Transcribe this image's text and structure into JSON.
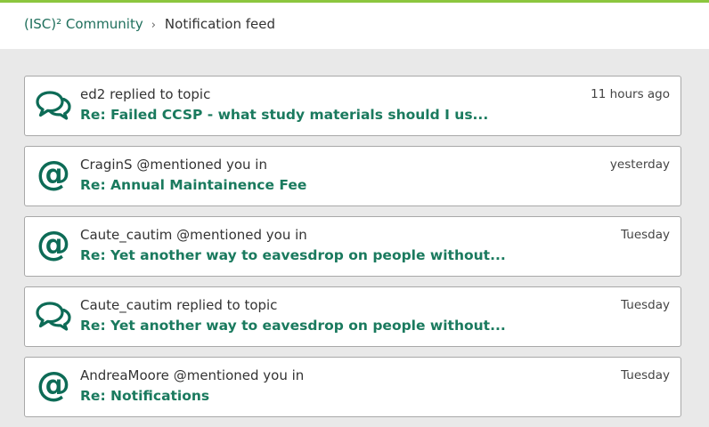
{
  "colors": {
    "accent": "#1a7a5e",
    "topbar": "#8cc63f",
    "background": "#e9e9e9"
  },
  "breadcrumb": {
    "root": "(ISC)² Community",
    "separator": "›",
    "current": "Notification feed"
  },
  "notifications": [
    {
      "icon": "chat-bubbles-icon",
      "actor": "ed2",
      "action": "replied to topic",
      "title": "Re: Failed CCSP - what study materials should I us...",
      "time": "11 hours ago"
    },
    {
      "icon": "at-mention-icon",
      "actor": "CraginS",
      "action": "@mentioned you in",
      "title": "Re: Annual Maintainence Fee",
      "time": "yesterday"
    },
    {
      "icon": "at-mention-icon",
      "actor": "Caute_cautim",
      "action": "@mentioned you in",
      "title": "Re: Yet another way to eavesdrop on people without...",
      "time": "Tuesday"
    },
    {
      "icon": "chat-bubbles-icon",
      "actor": "Caute_cautim",
      "action": "replied to topic",
      "title": "Re: Yet another way to eavesdrop on people without...",
      "time": "Tuesday"
    },
    {
      "icon": "at-mention-icon",
      "actor": "AndreaMoore",
      "action": "@mentioned you in",
      "title": "Re: Notifications",
      "time": "Tuesday"
    }
  ]
}
